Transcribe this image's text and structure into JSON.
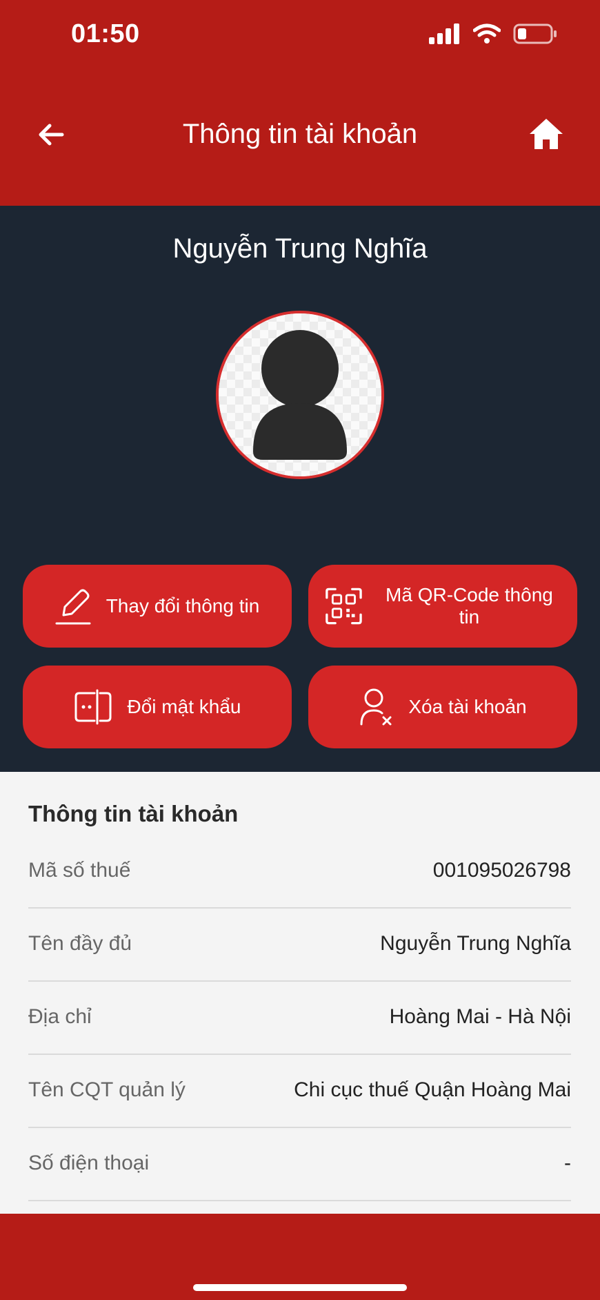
{
  "status_bar": {
    "time": "01:50"
  },
  "header": {
    "title": "Thông tin tài khoản"
  },
  "profile": {
    "name": "Nguyễn Trung Nghĩa"
  },
  "actions": [
    {
      "label": "Thay đổi thông tin",
      "icon": "edit-pen-icon"
    },
    {
      "label": "Mã QR-Code thông tin",
      "icon": "qr-code-icon"
    },
    {
      "label": "Đổi mật khẩu",
      "icon": "password-icon"
    },
    {
      "label": "Xóa tài khoản",
      "icon": "remove-user-icon"
    }
  ],
  "account_info": {
    "title": "Thông tin tài khoản",
    "rows": [
      {
        "key": "Mã số thuế",
        "value": "001095026798"
      },
      {
        "key": "Tên đầy đủ",
        "value": "Nguyễn Trung Nghĩa"
      },
      {
        "key": "Địa chỉ",
        "value": "Hoàng Mai - Hà Nội"
      },
      {
        "key": "Tên CQT quản lý",
        "value": "Chi cục thuế Quận Hoàng Mai"
      },
      {
        "key": "Số điện thoại",
        "value": "-"
      }
    ]
  },
  "colors": {
    "brand_red": "#b51c17",
    "button_red": "#d42626",
    "profile_bg": "#1c2633"
  }
}
